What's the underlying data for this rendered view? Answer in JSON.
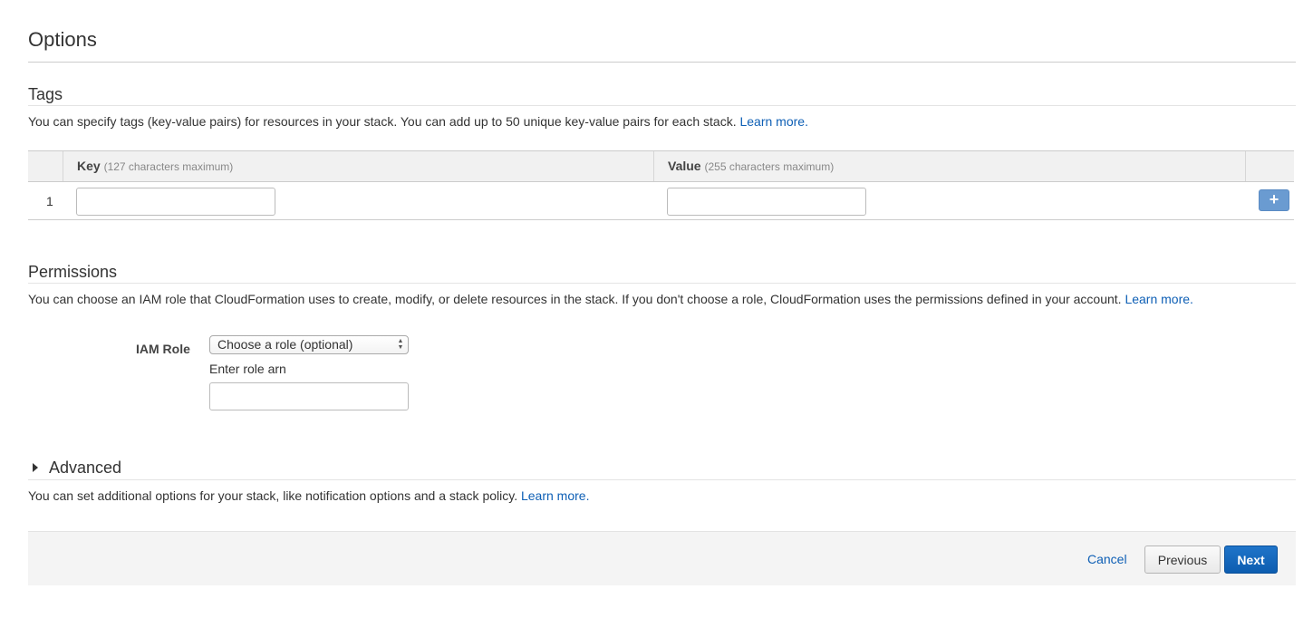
{
  "page": {
    "title": "Options"
  },
  "tags": {
    "title": "Tags",
    "description": "You can specify tags (key-value pairs) for resources in your stack. You can add up to 50 unique key-value pairs for each stack.",
    "learn_more": "Learn more.",
    "columns": {
      "key_label": "Key",
      "key_hint": "(127 characters maximum)",
      "value_label": "Value",
      "value_hint": "(255 characters maximum)"
    },
    "rows": [
      {
        "index": "1",
        "key": "",
        "value": ""
      }
    ],
    "add_button_label": "+"
  },
  "permissions": {
    "title": "Permissions",
    "description": "You can choose an IAM role that CloudFormation uses to create, modify, or delete resources in the stack. If you don't choose a role, CloudFormation uses the permissions defined in your account.",
    "learn_more": "Learn more.",
    "iam_role_label": "IAM Role",
    "role_select_value": "Choose a role (optional)",
    "role_arn_label": "Enter role arn",
    "role_arn_value": ""
  },
  "advanced": {
    "title": "Advanced",
    "description": "You can set additional options for your stack, like notification options and a stack policy.",
    "learn_more": "Learn more."
  },
  "footer": {
    "cancel_label": "Cancel",
    "previous_label": "Previous",
    "next_label": "Next"
  },
  "colors": {
    "link": "#0e5fb5",
    "primary_button": "#1f74c9",
    "add_button": "#6a9bd1"
  }
}
